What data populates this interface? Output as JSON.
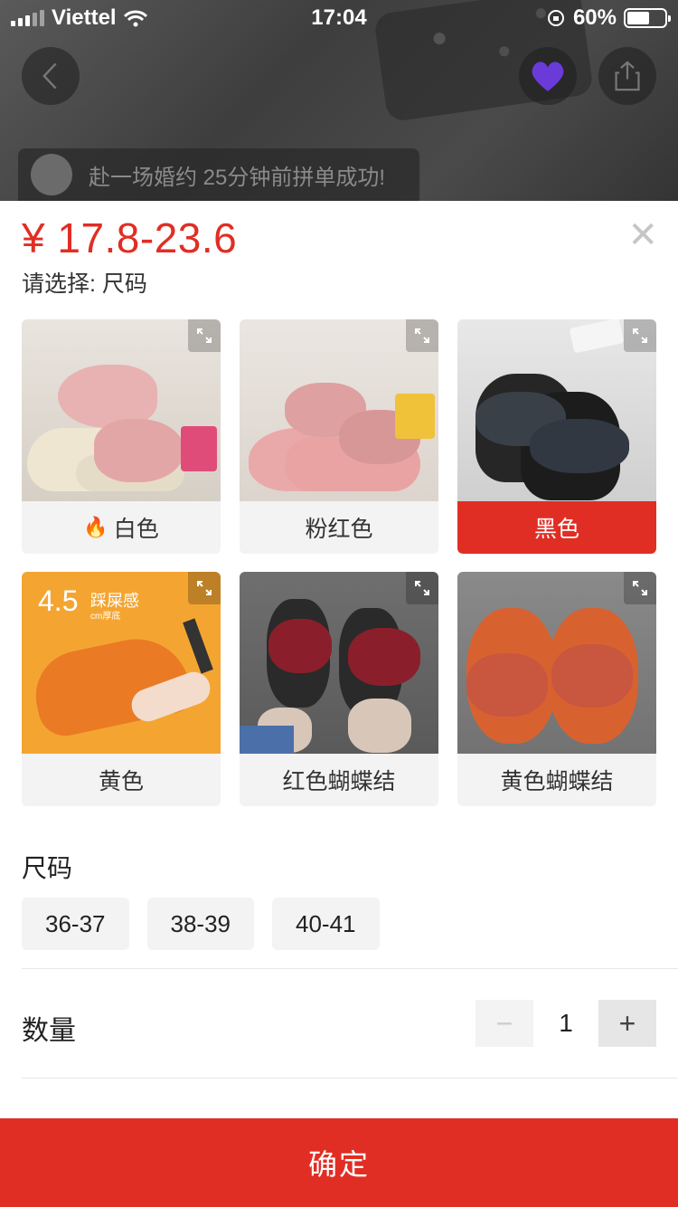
{
  "status_bar": {
    "carrier": "Viettel",
    "time": "17:04",
    "battery_percent": "60%",
    "battery_level": 0.6
  },
  "toast": {
    "text": "赴一场婚约 25分钟前拼单成功!"
  },
  "sheet": {
    "price": "¥ 17.8-23.6",
    "selection_prompt": "请选择: 尺码",
    "colors": [
      {
        "label": "白色",
        "hot": true
      },
      {
        "label": "粉红色",
        "hot": false
      },
      {
        "label": "黑色",
        "hot": false,
        "selected": true
      },
      {
        "label": "黄色",
        "hot": false,
        "badge_main": "4.5",
        "badge_sub": "踩屎感",
        "badge_small": "cm厚底"
      },
      {
        "label": "红色蝴蝶结",
        "hot": false
      },
      {
        "label": "黄色蝴蝶结",
        "hot": false
      }
    ],
    "size_title": "尺码",
    "sizes": [
      "36-37",
      "38-39",
      "40-41"
    ],
    "quantity_label": "数量",
    "quantity": "1",
    "minus": "−",
    "plus": "+",
    "confirm": "确定"
  },
  "colors": {
    "accent": "#e02e24"
  }
}
